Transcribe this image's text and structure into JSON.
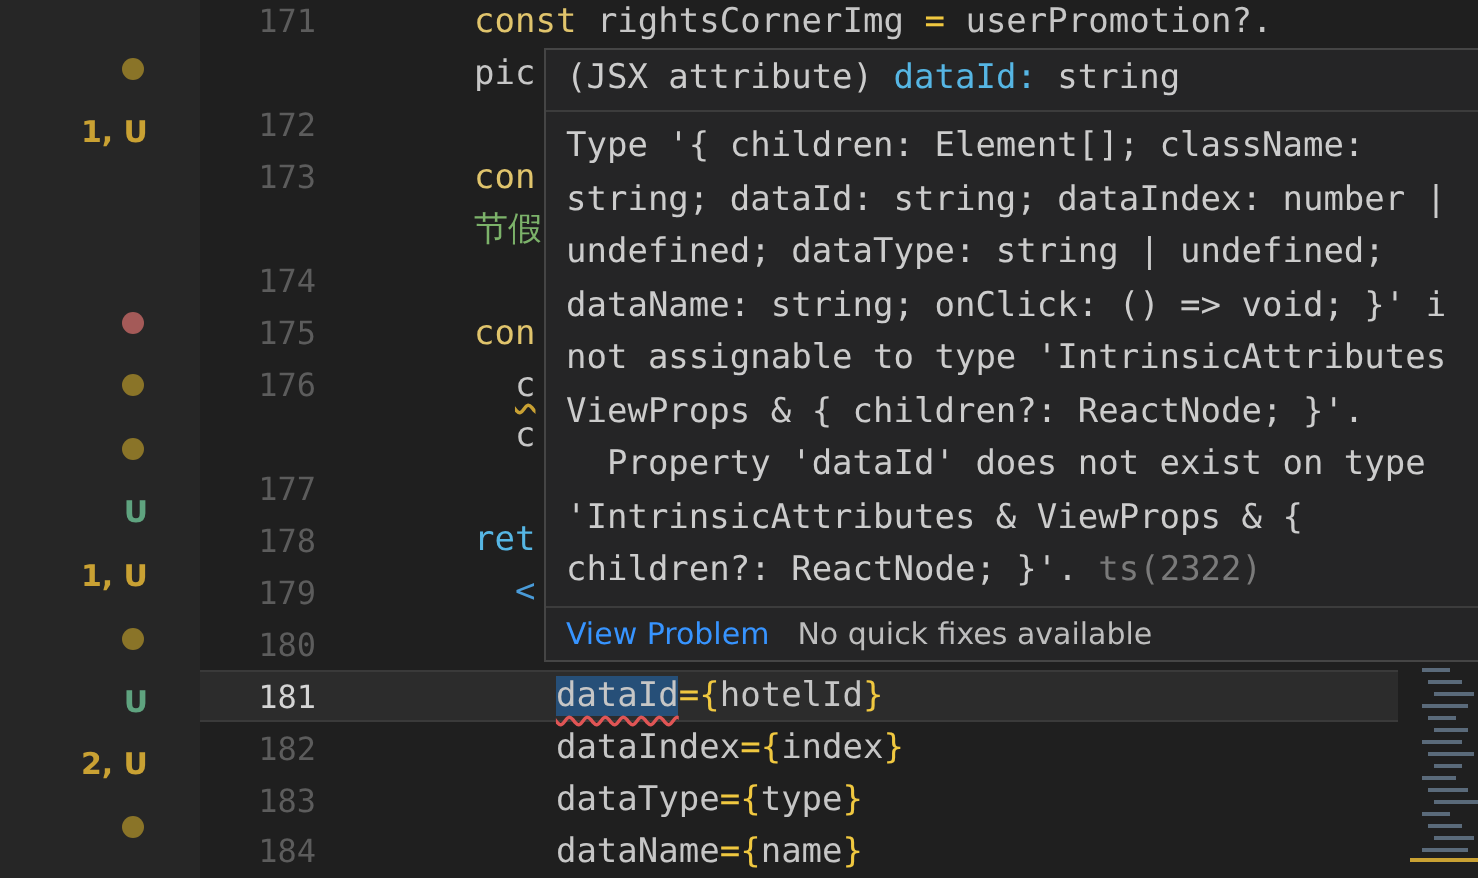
{
  "explorer": {
    "items": [
      {
        "kind": "dot",
        "color": "#8a7428"
      },
      {
        "kind": "label",
        "text": "1, U",
        "color": "#c9a133"
      },
      {
        "kind": "blank"
      },
      {
        "kind": "blank"
      },
      {
        "kind": "dot",
        "color": "#a45a58"
      },
      {
        "kind": "dot",
        "color": "#8a7428"
      },
      {
        "kind": "dot",
        "color": "#8a7428"
      },
      {
        "kind": "label",
        "text": "U",
        "color": "#5fa37f"
      },
      {
        "kind": "label",
        "text": "1, U",
        "color": "#c9a133"
      },
      {
        "kind": "dot",
        "color": "#8a7428"
      },
      {
        "kind": "label",
        "text": "U",
        "color": "#5fa37f"
      },
      {
        "kind": "label",
        "text": "2, U",
        "color": "#c9a133"
      },
      {
        "kind": "dot",
        "color": "#8a7428"
      }
    ]
  },
  "editor": {
    "lines": [
      {
        "number": "171",
        "current": false,
        "tokens": [
          {
            "text": "const",
            "kind": "keyword"
          },
          {
            "text": " rightsCornerImg ",
            "kind": "ident"
          },
          {
            "text": "=",
            "kind": "operator"
          },
          {
            "text": " userPromotion?.",
            "kind": "ident"
          }
        ]
      },
      {
        "current": false,
        "tokens": [
          {
            "text": "pic",
            "kind": "ident"
          }
        ]
      },
      {
        "number": "172",
        "current": false
      },
      {
        "number": "173",
        "current": false,
        "tokens": [
          {
            "text": "con",
            "kind": "keyword"
          }
        ]
      },
      {
        "current": false,
        "tokens": [
          {
            "text": "节假",
            "kind": "string"
          }
        ]
      },
      {
        "number": "174",
        "current": false
      },
      {
        "number": "175",
        "current": false,
        "tokens": [
          {
            "text": "con",
            "kind": "keyword"
          }
        ]
      },
      {
        "number": "176",
        "current": false,
        "tokens": [
          {
            "text": "  c",
            "kind": "ident",
            "warning": true
          }
        ]
      },
      {
        "current": false,
        "tokens": [
          {
            "text": "  c",
            "kind": "ident"
          }
        ]
      },
      {
        "number": "177",
        "current": false
      },
      {
        "number": "178",
        "current": false,
        "tokens": [
          {
            "text": "ret",
            "kind": "control"
          }
        ]
      },
      {
        "number": "179",
        "current": false,
        "tokens": [
          {
            "text": "  <",
            "kind": "tag"
          }
        ]
      },
      {
        "number": "180",
        "current": false
      },
      {
        "number": "181",
        "current": true,
        "tokens": [
          {
            "text": "    dataId",
            "kind": "ident",
            "error": true,
            "selected": true
          },
          {
            "text": "={",
            "kind": "operator"
          },
          {
            "text": "hotelId",
            "kind": "ident"
          },
          {
            "text": "}",
            "kind": "operator"
          }
        ]
      },
      {
        "number": "182",
        "current": false,
        "tokens": [
          {
            "text": "    dataIndex",
            "kind": "ident"
          },
          {
            "text": "={",
            "kind": "operator"
          },
          {
            "text": "index",
            "kind": "ident"
          },
          {
            "text": "}",
            "kind": "operator"
          }
        ]
      },
      {
        "number": "183",
        "current": false,
        "tokens": [
          {
            "text": "    dataType",
            "kind": "ident"
          },
          {
            "text": "={",
            "kind": "operator"
          },
          {
            "text": "type",
            "kind": "ident"
          },
          {
            "text": "}",
            "kind": "operator"
          }
        ]
      },
      {
        "number": "184",
        "current": false,
        "tokens": [
          {
            "text": "    dataName",
            "kind": "ident"
          },
          {
            "text": "={",
            "kind": "operator"
          },
          {
            "text": "name",
            "kind": "ident"
          },
          {
            "text": "}",
            "kind": "operator"
          }
        ]
      }
    ]
  },
  "hover": {
    "signature": [
      {
        "text": "(JSX attribute) ",
        "kind": "plain"
      },
      {
        "text": "dataId:",
        "kind": "name"
      },
      {
        "text": " string",
        "kind": "plain"
      }
    ],
    "message": [
      "Type '{ children: Element[]; className:",
      "string; dataId: string; dataIndex: number |",
      "undefined; dataType: string | undefined;",
      "dataName: string; onClick: () => void; }' i",
      "not assignable to type 'IntrinsicAttributes",
      "ViewProps & { children?: ReactNode; }'.",
      "  Property 'dataId' does not exist on type",
      "'IntrinsicAttributes & ViewProps & {",
      "children?: ReactNode; }'."
    ],
    "code": "ts(2322)",
    "action": "View Problem",
    "note": "No quick fixes available"
  }
}
